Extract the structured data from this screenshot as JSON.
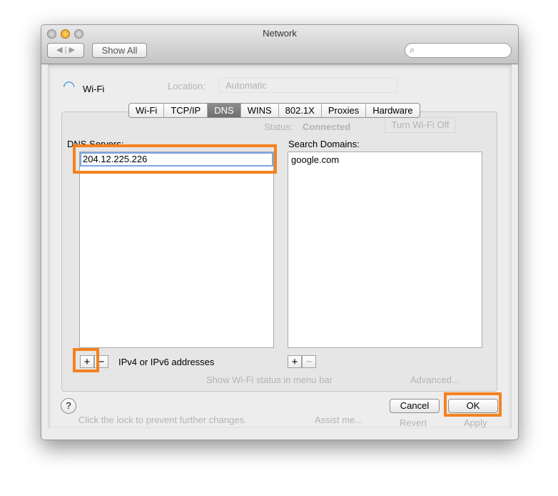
{
  "window": {
    "title": "Network",
    "show_all": "Show All",
    "search_placeholder": ""
  },
  "background": {
    "location_label": "Location:",
    "location_value": "Automatic",
    "status_label": "Status:",
    "status_value": "Connected",
    "turn_off": "Turn Wi-Fi Off",
    "show_status": "Show Wi-Fi status in menu bar",
    "advanced": "Advanced...",
    "lock_text": "Click the lock to prevent further changes.",
    "assist": "Assist me...",
    "revert": "Revert",
    "apply": "Apply"
  },
  "sheet": {
    "interface_name": "Wi-Fi",
    "tabs": [
      {
        "label": "Wi-Fi"
      },
      {
        "label": "TCP/IP"
      },
      {
        "label": "DNS",
        "selected": true
      },
      {
        "label": "WINS"
      },
      {
        "label": "802.1X"
      },
      {
        "label": "Proxies"
      },
      {
        "label": "Hardware"
      }
    ],
    "dns_servers": {
      "label": "DNS Servers:",
      "editing_value": "204.12.225.226",
      "hint": "IPv4 or IPv6 addresses"
    },
    "search_domains": {
      "label": "Search Domains:",
      "items": [
        "google.com"
      ]
    },
    "add": "+",
    "remove": "−",
    "help": "?",
    "cancel": "Cancel",
    "ok": "OK"
  },
  "colors": {
    "highlight": "#f4821f",
    "selected_tab": "#7a7a7a"
  }
}
